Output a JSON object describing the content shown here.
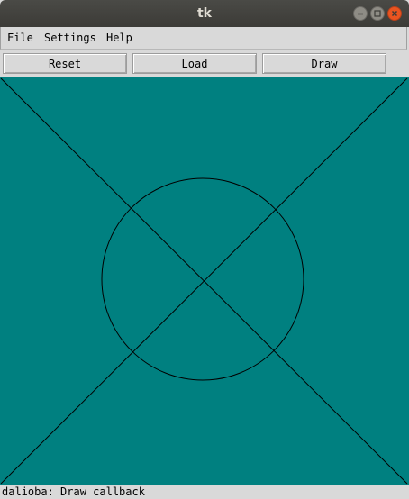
{
  "window": {
    "title": "tk"
  },
  "menubar": {
    "items": [
      {
        "label": "File"
      },
      {
        "label": "Settings"
      },
      {
        "label": "Help"
      }
    ]
  },
  "toolbar": {
    "reset_label": "Reset",
    "load_label": "Load",
    "draw_label": "Draw"
  },
  "canvas": {
    "background_color": "#008080",
    "line_color": "#000000"
  },
  "status": {
    "text": "dalioba: Draw callback"
  }
}
